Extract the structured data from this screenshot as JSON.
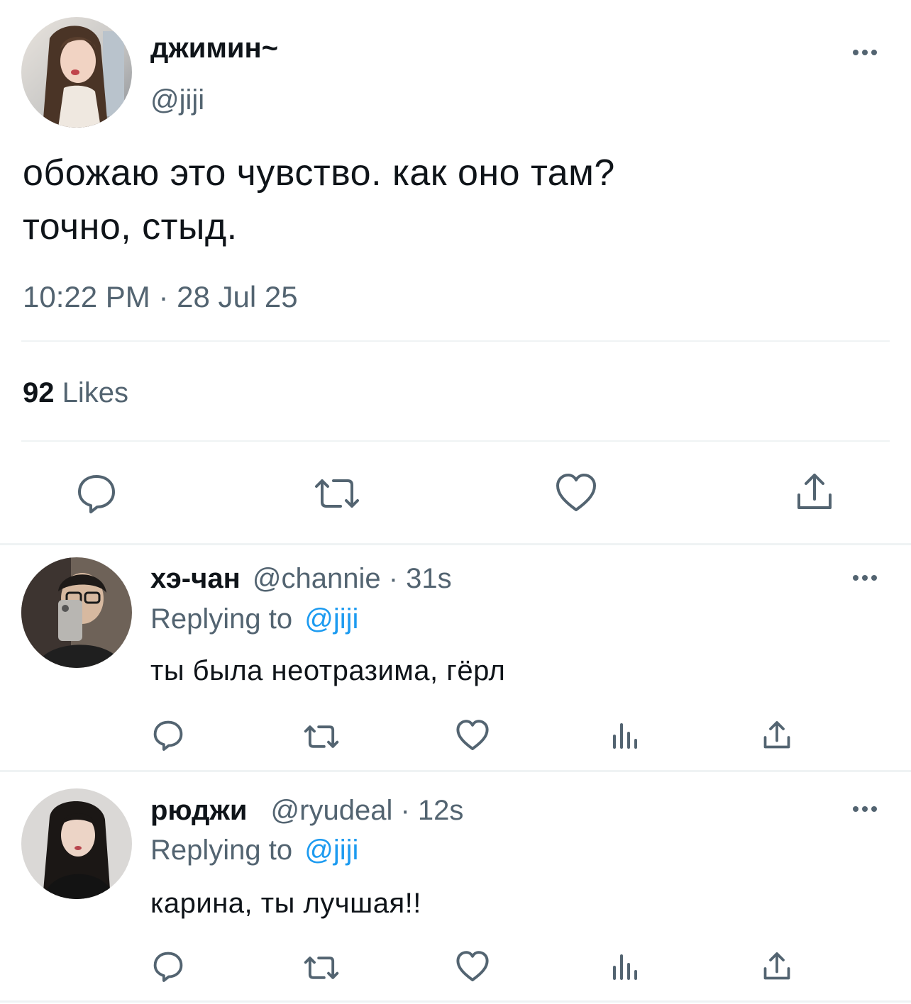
{
  "main_tweet": {
    "display_name": "джимин~",
    "handle": "@jiji",
    "text_line1": "обожаю это чувство. как оно там?",
    "text_line2": "точно, стыд.",
    "timestamp": "10:22 PM · 28 Jul 25",
    "likes_count": "92",
    "likes_label": "Likes"
  },
  "replies": [
    {
      "display_name": "хэ-чан",
      "handle_time": "@channie · 31s",
      "replying_prefix": "Replying to",
      "replying_handle": "@jiji",
      "text": "ты была неотразима, гёрл"
    },
    {
      "display_name": "рюджи",
      "handle_time": "@ryudeal · 12s",
      "replying_prefix": "Replying to",
      "replying_handle": "@jiji",
      "text": "карина, ты лучшая!!"
    }
  ],
  "icons": {
    "main_actions": [
      "reply-icon",
      "retweet-icon",
      "like-icon",
      "share-icon"
    ],
    "reply_actions": [
      "reply-icon",
      "retweet-icon",
      "like-icon",
      "views-icon",
      "share-icon"
    ],
    "menu": "more-icon"
  },
  "colors": {
    "text": "#0f1419",
    "secondary": "#536471",
    "link": "#1d9bf0",
    "divider": "#eff3f4"
  }
}
